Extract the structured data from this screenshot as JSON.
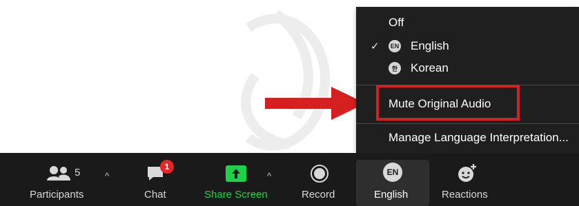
{
  "menu": {
    "items": [
      {
        "label": "Off",
        "checked": false
      },
      {
        "label": "English",
        "badge": "EN",
        "checked": true
      },
      {
        "label": "Korean",
        "badge": "한",
        "checked": false
      }
    ],
    "check_glyph": "✓",
    "mute_label": "Mute Original Audio",
    "manage_label": "Manage Language Interpretation...",
    "highlighted_item": "Mute Original Audio"
  },
  "toolbar": {
    "participants": {
      "label": "Participants",
      "count": "5",
      "icon": "participants-icon"
    },
    "chat": {
      "label": "Chat",
      "unread": "1",
      "icon": "chat-icon"
    },
    "share": {
      "label": "Share Screen",
      "icon": "share-screen-icon",
      "color": "#1fd14a"
    },
    "record": {
      "label": "Record",
      "icon": "record-icon"
    },
    "language": {
      "label": "English",
      "badge": "EN",
      "icon": "language-icon"
    },
    "reactions": {
      "label": "Reactions",
      "icon": "reactions-icon"
    }
  },
  "colors": {
    "menu_bg": "#1f1f1f",
    "toolbar_bg": "#1a1a1a",
    "annotation_red": "#d42020",
    "share_green": "#1fd14a"
  }
}
